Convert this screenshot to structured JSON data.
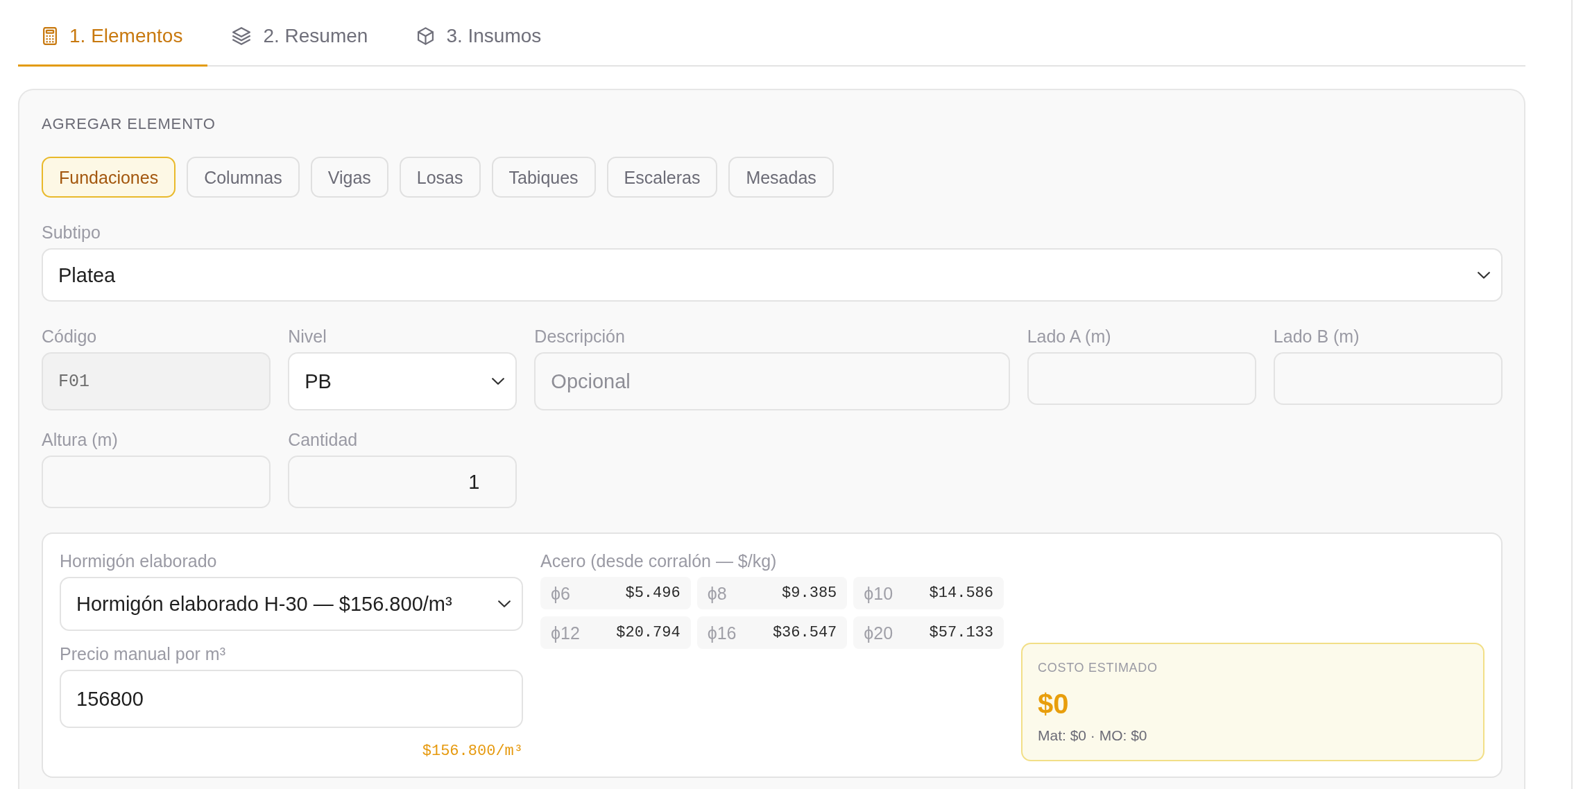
{
  "tabs": [
    {
      "label": "1. Elementos",
      "selected": true
    },
    {
      "label": "2. Resumen",
      "selected": false
    },
    {
      "label": "3. Insumos",
      "selected": false
    }
  ],
  "add_element": {
    "title": "AGREGAR ELEMENTO",
    "categories": [
      {
        "label": "Fundaciones",
        "selected": true
      },
      {
        "label": "Columnas",
        "selected": false
      },
      {
        "label": "Vigas",
        "selected": false
      },
      {
        "label": "Losas",
        "selected": false
      },
      {
        "label": "Tabiques",
        "selected": false
      },
      {
        "label": "Escaleras",
        "selected": false
      },
      {
        "label": "Mesadas",
        "selected": false
      }
    ],
    "subtype": {
      "label": "Subtipo",
      "value": "Platea"
    },
    "fields": [
      {
        "kind": "code",
        "label": "Código",
        "value": "F01"
      },
      {
        "kind": "select",
        "label": "Nivel",
        "value": "PB"
      },
      {
        "kind": "text",
        "label": "Descripción",
        "placeholder": "Opcional"
      },
      {
        "kind": "number",
        "label": "Lado A (m)"
      },
      {
        "kind": "number",
        "label": "Lado B (m)"
      },
      {
        "kind": "number",
        "label": "Altura (m)"
      },
      {
        "kind": "number",
        "label": "Cantidad",
        "value": "1"
      }
    ],
    "concrete": {
      "label": "Hormigón elaborado",
      "value": "Hormigón elaborado H-30 — $156.800/m³"
    },
    "manual_price": {
      "label": "Precio manual por m³",
      "value": "156800",
      "formatted": "$156.800/m³"
    },
    "steel": {
      "label": "Acero (desde corralón — $/kg)",
      "prices": [
        {
          "diameter": "ϕ6",
          "price": "$5.496"
        },
        {
          "diameter": "ϕ8",
          "price": "$9.385"
        },
        {
          "diameter": "ϕ10",
          "price": "$14.586"
        },
        {
          "diameter": "ϕ12",
          "price": "$20.794"
        },
        {
          "diameter": "ϕ16",
          "price": "$36.547"
        },
        {
          "diameter": "ϕ20",
          "price": "$57.133"
        }
      ]
    },
    "estimate": {
      "title": "COSTO ESTIMADO",
      "total": "$0",
      "breakdown": "Mat: $0 · MO: $0"
    }
  }
}
